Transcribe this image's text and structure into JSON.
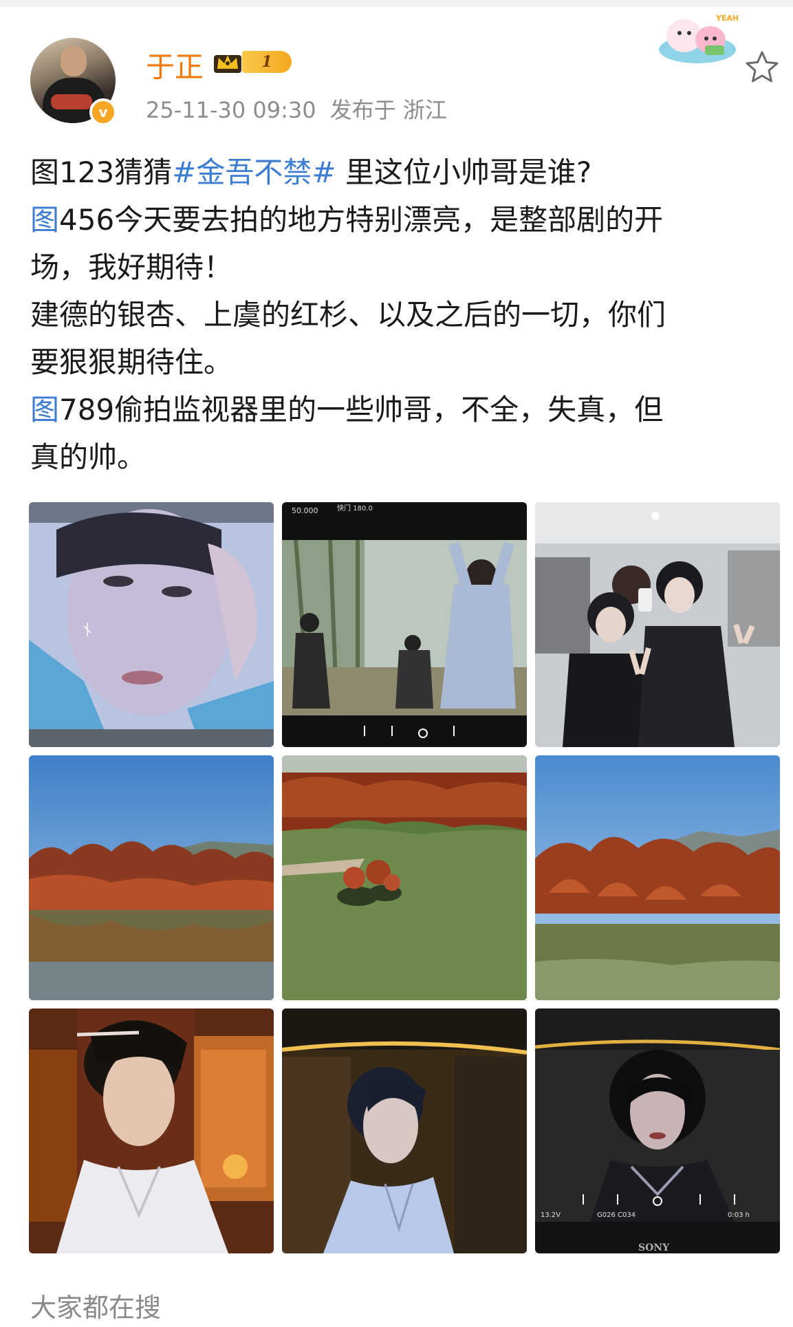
{
  "post": {
    "author": {
      "name": "于正",
      "vip_level": "1",
      "avatar_icon": "avatar-photo",
      "verified_icon": "verified-badge-icon"
    },
    "timestamp": "25-11-30 09:30",
    "location": "发布于 浙江",
    "sticker_text": "YEAH!",
    "text": {
      "line1_pre": "图123猜猜",
      "hashtag": "#金吾不禁#",
      "line1_post": " 里这位小帅哥是谁?",
      "line2_tu": "图",
      "line2_rest": "456今天要去拍的地方特别漂亮，是整部剧的开",
      "line3": "场，我好期待！",
      "line4": "建德的银杏、上虞的红杉、以及之后的一切，你们",
      "line5": "要狠狠期待住。",
      "line6_tu": "图",
      "line6_rest": "789偷拍监视器里的一些帅哥，不全，失真，但",
      "line7": "真的帅。"
    },
    "photos": [
      {
        "subject": "monitor-closeup-actor",
        "overlay_text": ""
      },
      {
        "subject": "action-scene-monitor",
        "overlay_text_left": "50.000",
        "overlay_text_right": "快门 180.0"
      },
      {
        "subject": "backstage-selfie",
        "overlay_text": ""
      },
      {
        "subject": "lake-red-cedars",
        "overlay_text": ""
      },
      {
        "subject": "aerial-lake-island",
        "overlay_text": ""
      },
      {
        "subject": "lake-red-trees-shore",
        "overlay_text": ""
      },
      {
        "subject": "actor-white-robe-hall",
        "overlay_text": ""
      },
      {
        "subject": "monitor-actor-blue-robe",
        "overlay_text": ""
      },
      {
        "subject": "monitor-actor-dark",
        "overlay_text_a": "13.2V",
        "overlay_text_b": "G026  C034",
        "overlay_text_c": "0:03 h",
        "overlay_text_d": "SONY"
      }
    ]
  },
  "footer": {
    "search_label": "大家都在搜"
  },
  "colors": {
    "username": "#f27a0b",
    "link": "#3c7dd2",
    "meta": "#8c8c8c"
  }
}
